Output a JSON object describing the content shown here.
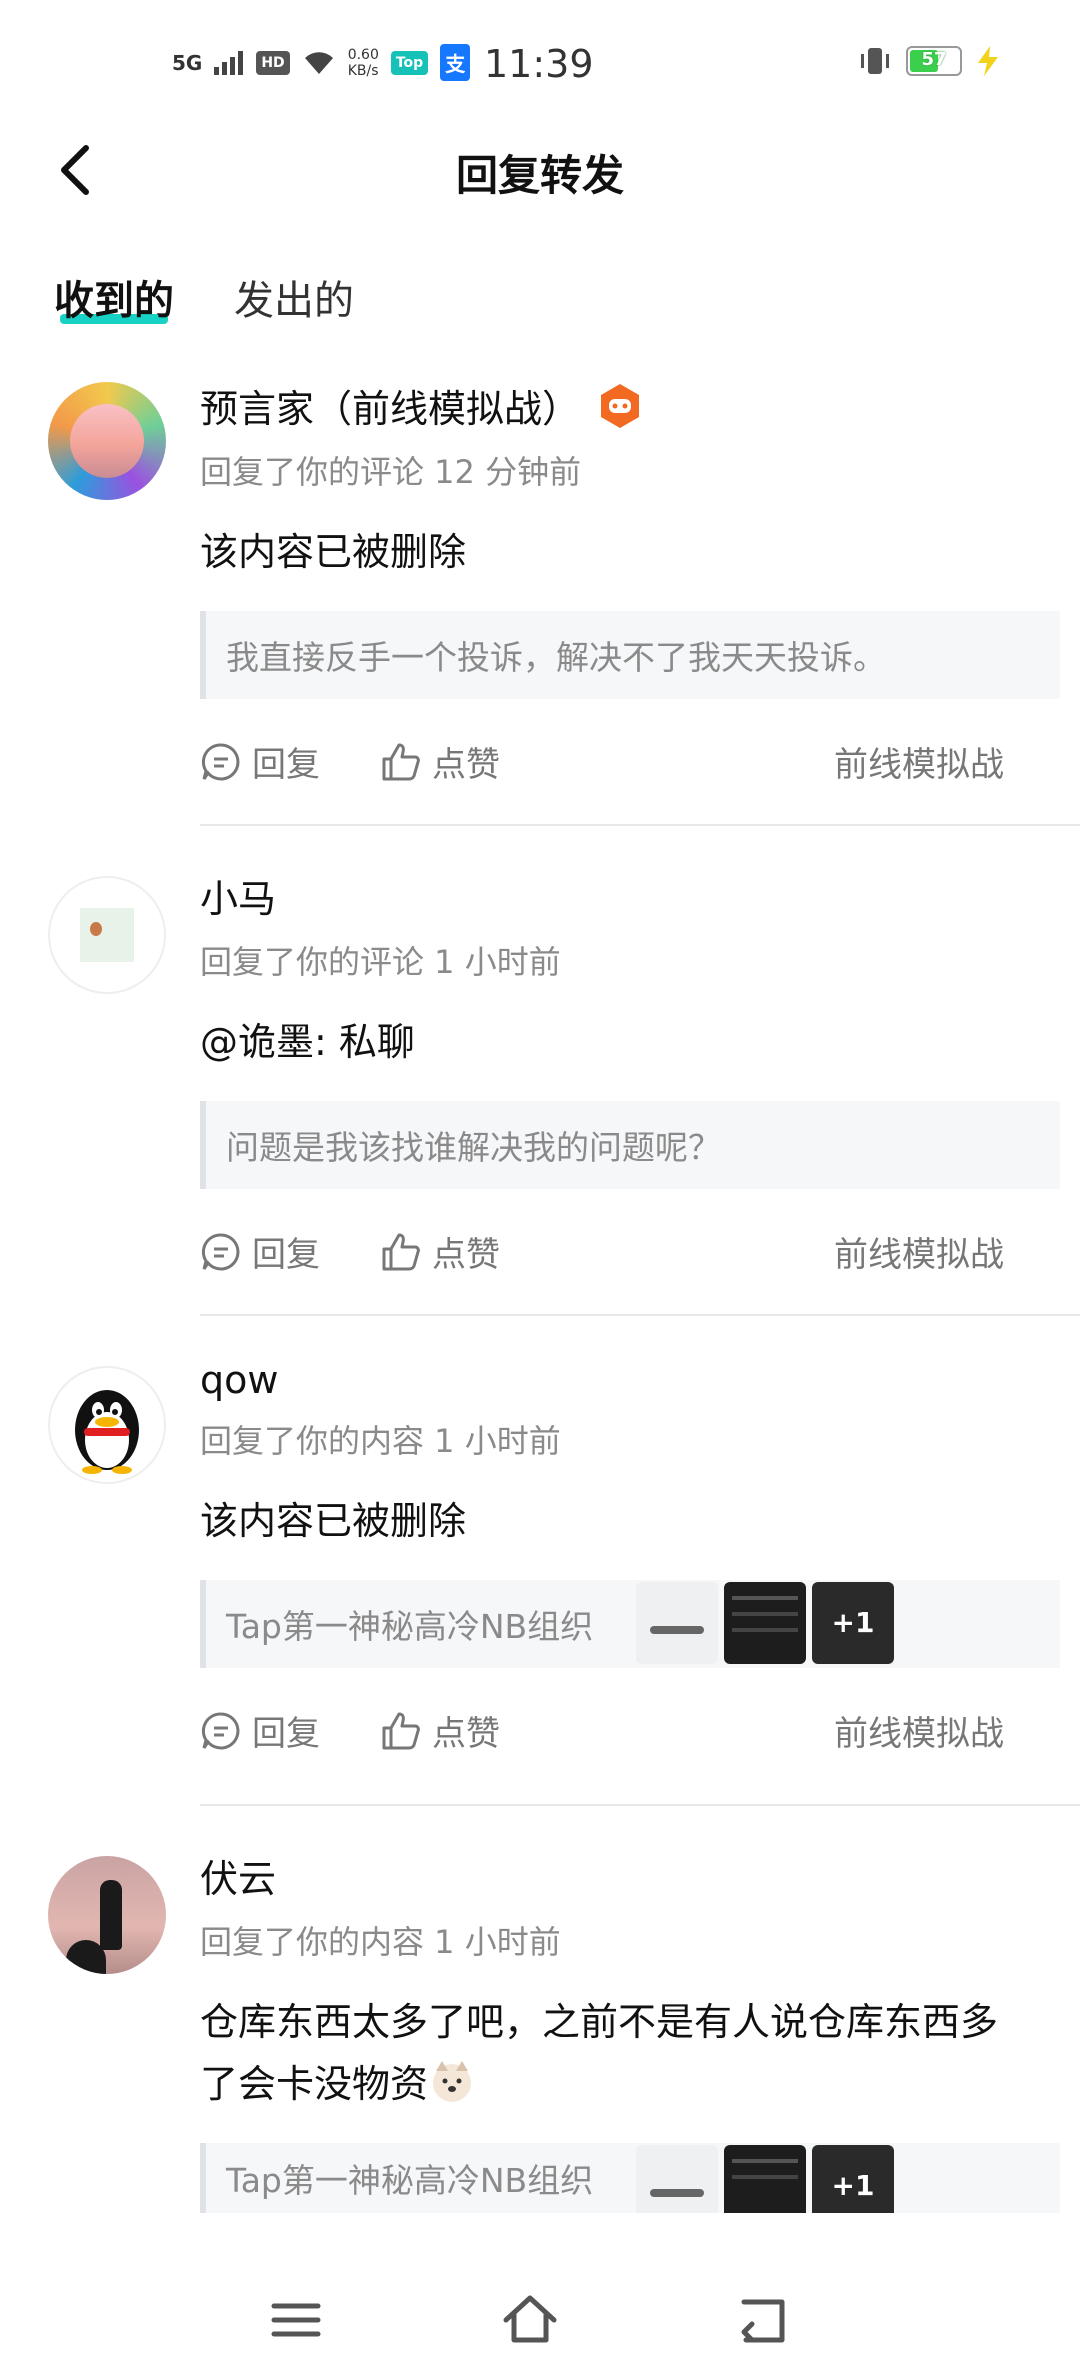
{
  "status_bar": {
    "network": "5G",
    "hd": "HD",
    "speed_value": "0.60",
    "speed_unit": "KB/s",
    "app_badge_1": "Top",
    "app_badge_2": "支",
    "time": "11:39",
    "battery": "57"
  },
  "header": {
    "title": "回复转发"
  },
  "tabs": [
    {
      "label": "收到的",
      "active": true
    },
    {
      "label": "发出的",
      "active": false
    }
  ],
  "items": [
    {
      "username": "预言家（前线模拟战）",
      "meta": "回复了你的评论 12 分钟前",
      "text": "该内容已被删除",
      "quote": "我直接反手一个投诉，解决不了我天天投诉。",
      "reply_label": "回复",
      "like_label": "点赞",
      "topic": "前线模拟战"
    },
    {
      "username": "小马",
      "meta": "回复了你的评论 1 小时前",
      "text": "@诡墨: 私聊",
      "quote": "问题是我该找谁解决我的问题呢？",
      "reply_label": "回复",
      "like_label": "点赞",
      "topic": "前线模拟战"
    },
    {
      "username": "qow",
      "meta": "回复了你的内容 1 小时前",
      "text": "该内容已被删除",
      "quote": "Tap第一神秘高冷NB组织",
      "more_count": "+1",
      "reply_label": "回复",
      "like_label": "点赞",
      "topic": "前线模拟战"
    },
    {
      "username": "伏云",
      "meta": "回复了你的内容 1 小时前",
      "text": "仓库东西太多了吧，之前不是有人说仓库东西多了会卡没物资",
      "quote": "Tap第一神秘高冷NB组织",
      "more_count": "+1"
    }
  ],
  "colors": {
    "accent": "#18d3c5",
    "badge_orange": "#f26a22"
  }
}
